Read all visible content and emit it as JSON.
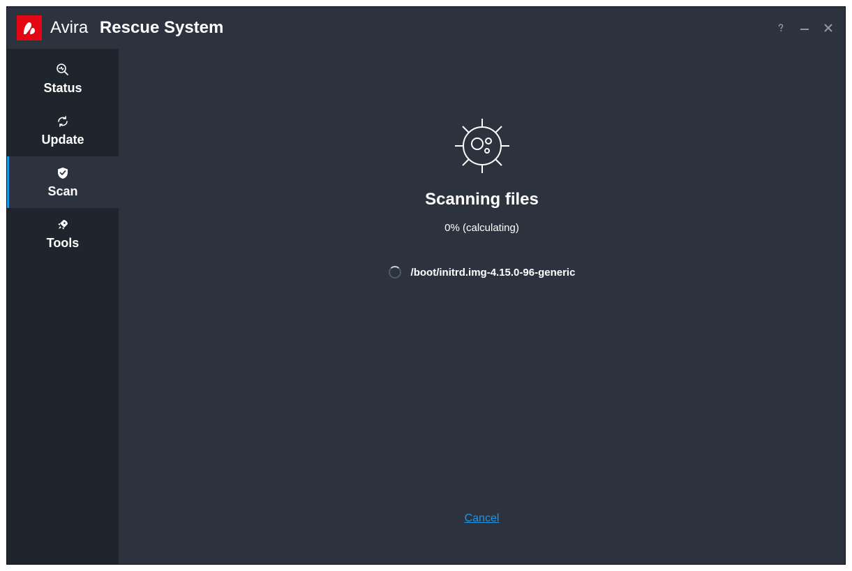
{
  "header": {
    "brand": "Avira",
    "product": "Rescue System"
  },
  "sidebar": {
    "items": [
      {
        "label": "Status"
      },
      {
        "label": "Update"
      },
      {
        "label": "Scan"
      },
      {
        "label": "Tools"
      }
    ],
    "active_index": 2
  },
  "scan": {
    "title": "Scanning files",
    "progress_text": "0% (calculating)",
    "current_file": "/boot/initrd.img-4.15.0-96-generic",
    "cancel_label": "Cancel"
  }
}
